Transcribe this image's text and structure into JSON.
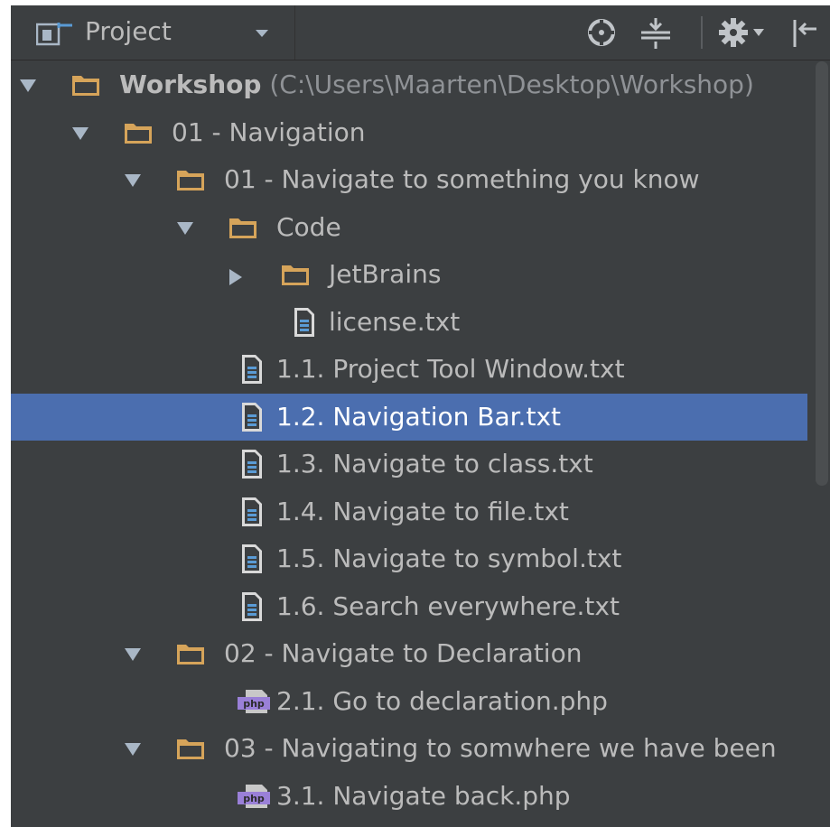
{
  "toolbar": {
    "title": "Project",
    "icons": [
      "project-view-icon",
      "dropdown-arrow-icon",
      "locate-icon",
      "collapse-all-icon",
      "settings-icon",
      "hide-icon"
    ]
  },
  "tree": [
    {
      "name": "Workshop",
      "path": "(C:\\Users\\Maarten\\Desktop\\Workshop)",
      "type": "folder",
      "expanded": true
    },
    {
      "name": "01 - Navigation",
      "type": "folder",
      "expanded": true
    },
    {
      "name": "01 - Navigate to something you know",
      "type": "folder",
      "expanded": true
    },
    {
      "name": "Code",
      "type": "folder",
      "expanded": true
    },
    {
      "name": "JetBrains",
      "type": "folder",
      "expanded": false
    },
    {
      "name": "license.txt",
      "type": "text-file"
    },
    {
      "name": "1.1. Project Tool Window.txt",
      "type": "text-file"
    },
    {
      "name": "1.2. Navigation Bar.txt",
      "type": "text-file",
      "selected": true
    },
    {
      "name": "1.3. Navigate to class.txt",
      "type": "text-file"
    },
    {
      "name": "1.4. Navigate to file.txt",
      "type": "text-file"
    },
    {
      "name": "1.5. Navigate to symbol.txt",
      "type": "text-file"
    },
    {
      "name": "1.6. Search everywhere.txt",
      "type": "text-file"
    },
    {
      "name": "02 - Navigate to Declaration",
      "type": "folder",
      "expanded": true
    },
    {
      "name": "2.1. Go to declaration.php",
      "type": "php-file",
      "badge": "php"
    },
    {
      "name": "03 - Navigating to somwhere we have been",
      "type": "folder",
      "expanded": true
    },
    {
      "name": "3.1. Navigate back.php",
      "type": "php-file",
      "badge": "php"
    }
  ],
  "colors": {
    "panel": "#3c3f41",
    "selection": "#4b6eaf",
    "folder": "#d6a45a",
    "text": "#bbbbbb",
    "php_badge": "#9a80d8"
  }
}
